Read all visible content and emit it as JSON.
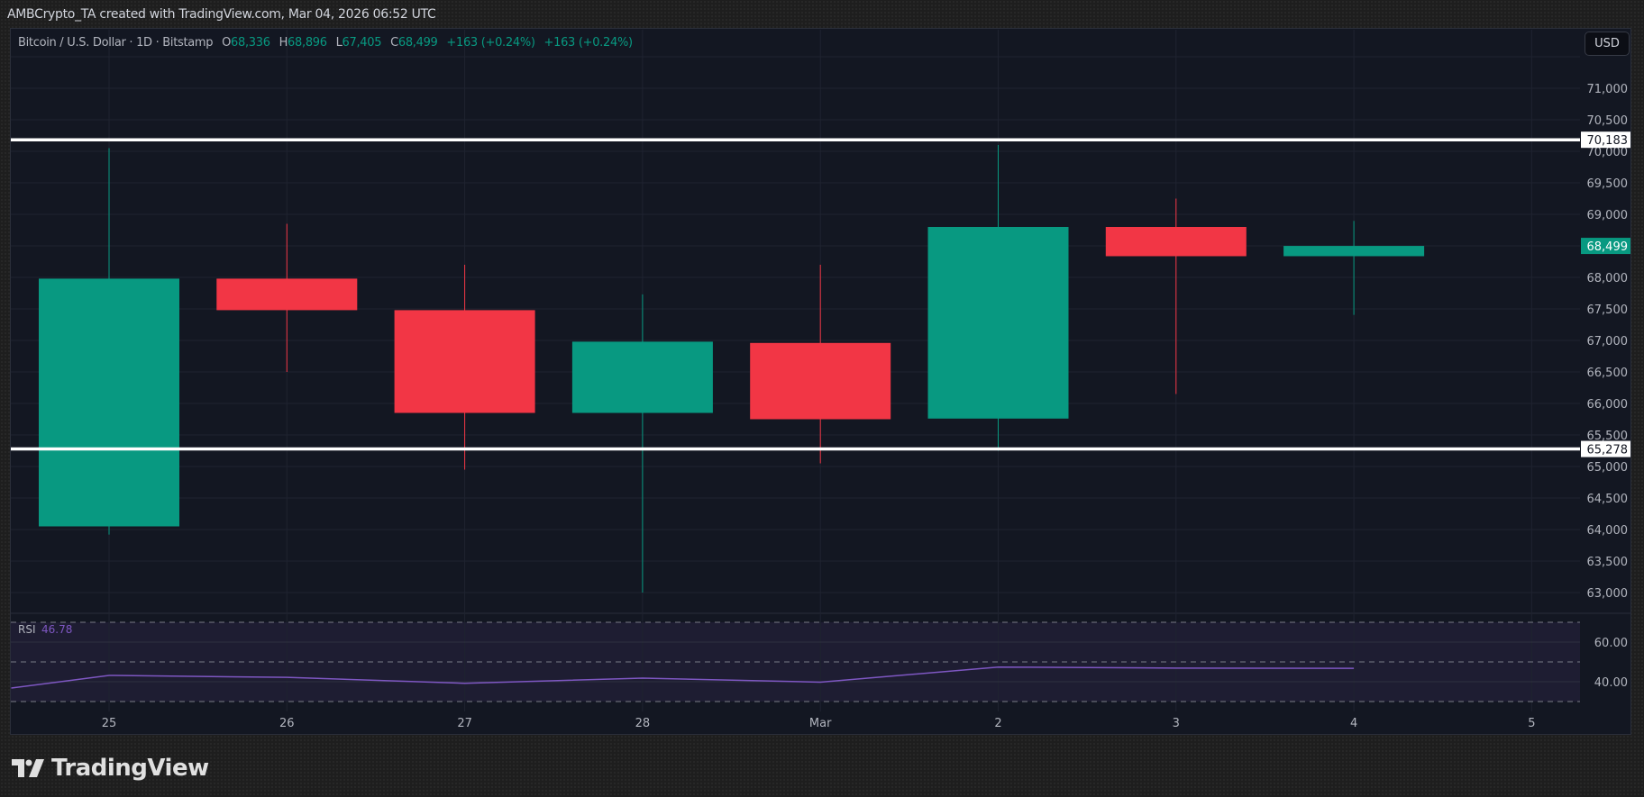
{
  "credit": "AMBCrypto_TA created with TradingView.com, Mar 04, 2026 06:52 UTC",
  "legend": {
    "symbol": "Bitcoin / U.S. Dollar · 1D · Bitstamp",
    "o_label": "O",
    "o": "68,336",
    "h_label": "H",
    "h": "68,896",
    "l_label": "L",
    "l": "67,405",
    "c_label": "C",
    "c": "68,499",
    "change1": "+163 (+0.24%)",
    "change2": "+163 (+0.24%)"
  },
  "currency_button": "USD",
  "brand": "TradingView",
  "colors": {
    "up": "#089981",
    "down": "#f23645",
    "rsi": "#7e57c2",
    "level": "#ffffff"
  },
  "chart_data": {
    "type": "candlestick",
    "title": "Bitcoin / U.S. Dollar · 1D · Bitstamp",
    "ylim": [
      62800,
      71500
    ],
    "y_ticks": [
      63000,
      63500,
      64000,
      64500,
      65000,
      65500,
      66000,
      66500,
      67000,
      67500,
      68000,
      68500,
      69000,
      69500,
      70000,
      70500,
      71000
    ],
    "y_tick_labels": [
      "63,000",
      "63,500",
      "64,000",
      "64,500",
      "65,000",
      "65,500",
      "66,000",
      "66,500",
      "67,000",
      "67,500",
      "68,000",
      "",
      "69,000",
      "69,500",
      "70,000",
      "70,500",
      "71,000"
    ],
    "x_labels": [
      "25",
      "26",
      "27",
      "28",
      "Mar",
      "2",
      "3",
      "4",
      "5"
    ],
    "candles": [
      {
        "date": "25",
        "open": 64050,
        "high": 70050,
        "low": 63920,
        "close": 67980
      },
      {
        "date": "26",
        "open": 67980,
        "high": 68850,
        "low": 66500,
        "close": 67480
      },
      {
        "date": "27",
        "open": 67480,
        "high": 68200,
        "low": 64950,
        "close": 65850
      },
      {
        "date": "28",
        "open": 65850,
        "high": 67730,
        "low": 63000,
        "close": 66980
      },
      {
        "date": "Mar",
        "open": 66960,
        "high": 68200,
        "low": 65050,
        "close": 65750
      },
      {
        "date": "2",
        "open": 65760,
        "high": 70100,
        "low": 65250,
        "close": 68800
      },
      {
        "date": "3",
        "open": 68800,
        "high": 69250,
        "low": 66150,
        "close": 68336
      },
      {
        "date": "4",
        "open": 68336,
        "high": 68896,
        "low": 67405,
        "close": 68499
      }
    ],
    "levels": [
      {
        "value": 70183,
        "label": "70,183"
      },
      {
        "value": 65278,
        "label": "65,278"
      }
    ],
    "last_price": {
      "value": 68499,
      "label": "68,499"
    },
    "rsi": {
      "label": "RSI",
      "value_label": "46.78",
      "ylim": [
        27,
        73
      ],
      "ticks": [
        {
          "value": 60,
          "label": "60.00"
        },
        {
          "value": 40,
          "label": "40.00"
        }
      ],
      "bands": [
        70,
        50,
        30
      ],
      "x_index": [
        -0.55,
        0,
        1,
        2,
        3,
        4,
        5,
        6,
        7
      ],
      "values": [
        36.8,
        43.2,
        42.2,
        39.2,
        41.8,
        39.8,
        47.4,
        46.9,
        46.78
      ]
    }
  }
}
